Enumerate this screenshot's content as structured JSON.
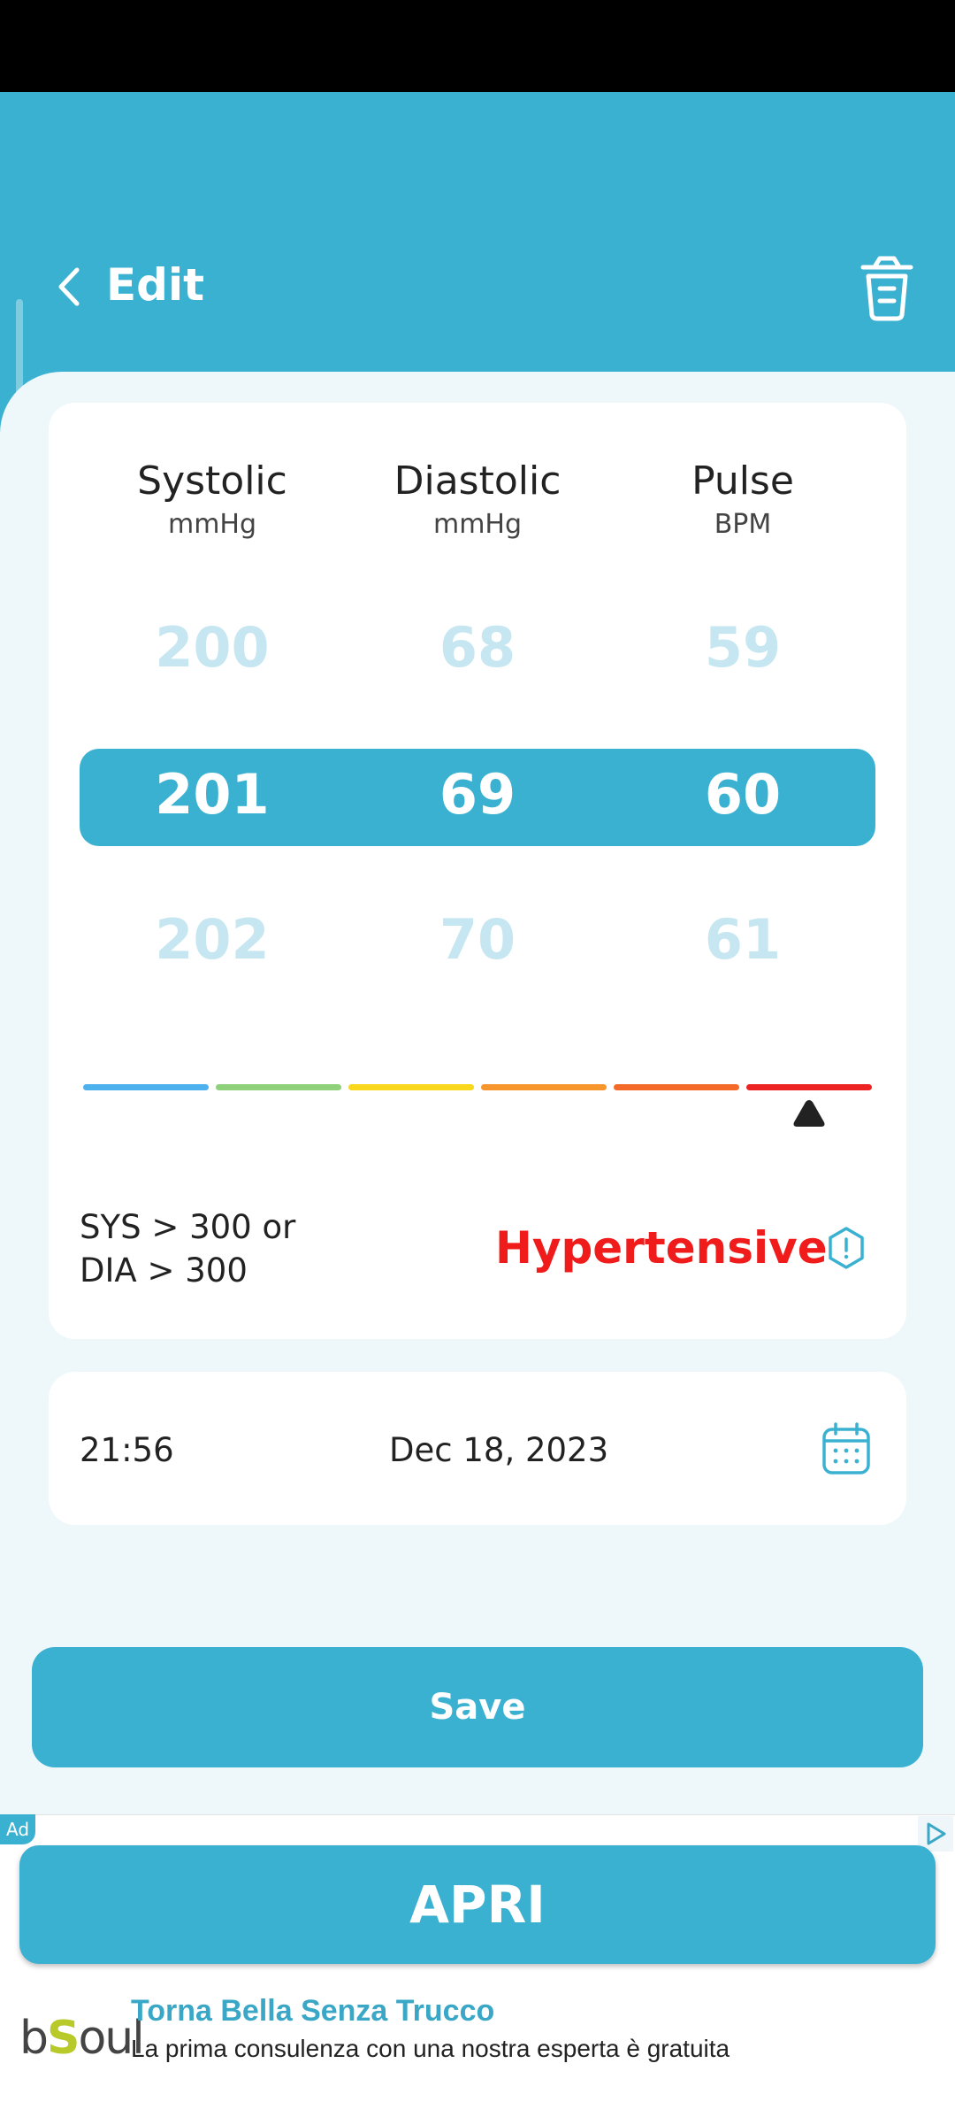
{
  "header": {
    "title": "Edit"
  },
  "columns": [
    {
      "title": "Systolic",
      "unit": "mmHg",
      "above": "200",
      "selected": "201",
      "below": "202"
    },
    {
      "title": "Diastolic",
      "unit": "mmHg",
      "above": "68",
      "selected": "69",
      "below": "70"
    },
    {
      "title": "Pulse",
      "unit": "BPM",
      "above": "59",
      "selected": "60",
      "below": "61"
    }
  ],
  "scale": {
    "colors": [
      "#4db1ee",
      "#8fd17a",
      "#f9d71c",
      "#f7962c",
      "#f46a28",
      "#ed2222"
    ],
    "active_segment": 6
  },
  "result": {
    "criteria_line1": "SYS > 300 or",
    "criteria_line2": "DIA > 300",
    "status": "Hypertensive",
    "status_color": "#f01b1b"
  },
  "datetime": {
    "time": "21:56",
    "date": "Dec 18, 2023"
  },
  "save_label": "Save",
  "ad": {
    "badge": "Ad",
    "button_label": "APRI",
    "brand_pre": "b",
    "brand_s": "S",
    "brand_post": "oul",
    "headline": "Torna Bella Senza Trucco",
    "subtext": "La prima consulenza con una nostra esperta è gratuita"
  },
  "colors": {
    "accent": "#3bb1d2",
    "background": "#eef8fb",
    "dim_value": "#c6e7f1"
  }
}
